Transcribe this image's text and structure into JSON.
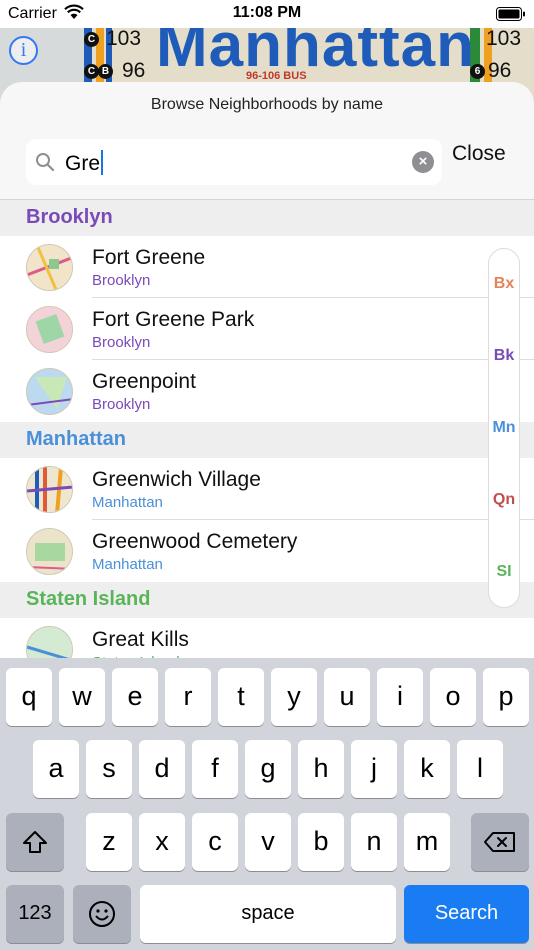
{
  "status_bar": {
    "carrier": "Carrier",
    "time": "11:08 PM"
  },
  "map": {
    "title": "Manhattan",
    "bus_label": "96-106 BUS",
    "route_left_top": "103",
    "route_left_bottom": "96",
    "route_right_top": "103",
    "route_right_bottom": "96",
    "bullet_c": "C",
    "bullet_b": "B",
    "bullet_6": "6",
    "info_label": "i"
  },
  "sheet": {
    "title": "Browse Neighborhoods by name",
    "search": {
      "value": "Gre",
      "clear_glyph": "×"
    },
    "close_label": "Close"
  },
  "colors": {
    "brooklyn": "#7a4bb8",
    "manhattan": "#4a90d9",
    "staten_island": "#5ab55a",
    "bronx": "#e8825a",
    "queens": "#c0504d",
    "accent": "#1a7cf2"
  },
  "sections": [
    {
      "header": "Brooklyn",
      "rows": [
        {
          "name": "Fort Greene",
          "borough": "Brooklyn"
        },
        {
          "name": "Fort Greene Park",
          "borough": "Brooklyn"
        },
        {
          "name": "Greenpoint",
          "borough": "Brooklyn"
        }
      ]
    },
    {
      "header": "Manhattan",
      "rows": [
        {
          "name": "Greenwich Village",
          "borough": "Manhattan"
        },
        {
          "name": "Greenwood Cemetery",
          "borough": "Manhattan"
        }
      ]
    },
    {
      "header": "Staten Island",
      "rows": [
        {
          "name": "Great Kills",
          "borough": "Staten Island"
        }
      ]
    }
  ],
  "index_bar": [
    "Bx",
    "Bk",
    "Mn",
    "Qn",
    "SI"
  ],
  "keyboard": {
    "row1": [
      "q",
      "w",
      "e",
      "r",
      "t",
      "y",
      "u",
      "i",
      "o",
      "p"
    ],
    "row2": [
      "a",
      "s",
      "d",
      "f",
      "g",
      "h",
      "j",
      "k",
      "l"
    ],
    "row3": [
      "z",
      "x",
      "c",
      "v",
      "b",
      "n",
      "m"
    ],
    "numbers_label": "123",
    "space_label": "space",
    "search_label": "Search",
    "icons": {
      "shift": "shift-icon",
      "delete": "delete-icon",
      "emoji": "emoji-icon"
    }
  }
}
